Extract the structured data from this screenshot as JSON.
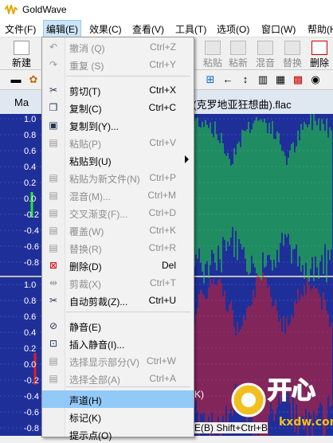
{
  "app": {
    "title": "GoldWave"
  },
  "menubar": [
    {
      "label": "文件(F)"
    },
    {
      "label": "编辑(E)"
    },
    {
      "label": "效果(C)"
    },
    {
      "label": "查看(V)"
    },
    {
      "label": "工具(T)"
    },
    {
      "label": "选项(O)"
    },
    {
      "label": "窗口(W)"
    },
    {
      "label": "帮助(H"
    }
  ],
  "toolbar": {
    "new": "新建",
    "partial_left": "",
    "paste": "粘贴",
    "paste_new": "粘新",
    "mix": "混音",
    "replace": "替换",
    "delete": "删除"
  },
  "document": {
    "title_left": "Ma",
    "title_right": "v (克罗地亚狂想曲).flac"
  },
  "wave_ticks": [
    "1.0",
    "0.8",
    "0.6",
    "0.4",
    "0.2",
    "0.0",
    "-0.2",
    "-0.4",
    "-0.6",
    "-0.8",
    "1.0",
    "0.8",
    "0.6",
    "0.4",
    "0.2",
    "0.0",
    "-0.2",
    "-0.4",
    "-0.6",
    "-0.8"
  ],
  "edit_menu": {
    "items": [
      {
        "label": "撤消 (Q)",
        "shortcut": "Ctrl+Z",
        "icon": "undo-icon",
        "disabled": true
      },
      {
        "label": "重复 (S)",
        "shortcut": "Ctrl+Y",
        "icon": "redo-icon",
        "disabled": true
      },
      {
        "label": "剪切(T)",
        "shortcut": "Ctrl+X",
        "icon": "scissors-icon",
        "disabled": false
      },
      {
        "label": "复制(C)",
        "shortcut": "Ctrl+C",
        "icon": "copy-icon",
        "disabled": false
      },
      {
        "label": "复制到(Y)...",
        "shortcut": "",
        "icon": "save-icon",
        "disabled": false
      },
      {
        "label": "粘贴(P)",
        "shortcut": "Ctrl+V",
        "icon": "paste-icon",
        "disabled": true
      },
      {
        "label": "粘贴到(U)",
        "shortcut": "",
        "icon": "",
        "disabled": false,
        "submenu": true
      },
      {
        "label": "粘贴为新文件(N)",
        "shortcut": "Ctrl+P",
        "icon": "paste-new-icon",
        "disabled": true
      },
      {
        "label": "混音(M)...",
        "shortcut": "Ctrl+M",
        "icon": "mix-icon",
        "disabled": true
      },
      {
        "label": "交叉渐变(F)...",
        "shortcut": "Ctrl+D",
        "icon": "crossfade-icon",
        "disabled": true
      },
      {
        "label": "覆盖(W)",
        "shortcut": "Ctrl+K",
        "icon": "overwrite-icon",
        "disabled": true
      },
      {
        "label": "替换(R)",
        "shortcut": "Ctrl+R",
        "icon": "replace-icon",
        "disabled": true
      },
      {
        "label": "删除(D)",
        "shortcut": "Del",
        "icon": "delete-icon",
        "disabled": false
      },
      {
        "label": "剪裁(X)",
        "shortcut": "Ctrl+T",
        "icon": "trim-icon",
        "disabled": true
      },
      {
        "label": "自动剪裁(Z)...",
        "shortcut": "Ctrl+U",
        "icon": "auto-trim-icon",
        "disabled": false
      },
      {
        "label": "静音(E)",
        "shortcut": "",
        "icon": "silence-icon",
        "disabled": false
      },
      {
        "label": "插入静音(I)...",
        "shortcut": "",
        "icon": "insert-silence-icon",
        "disabled": false
      },
      {
        "label": "选择显示部分(V)",
        "shortcut": "Ctrl+W",
        "icon": "select-view-icon",
        "disabled": true
      },
      {
        "label": "选择全部(A)",
        "shortcut": "Ctrl+A",
        "icon": "select-all-icon",
        "disabled": true
      },
      {
        "label": "声道(H)",
        "shortcut": "",
        "icon": "",
        "disabled": false,
        "highlighted": true
      },
      {
        "label": "标记(K)",
        "shortcut": "",
        "icon": "",
        "disabled": false
      },
      {
        "label": "提示点(O)",
        "shortcut": "",
        "icon": "",
        "disabled": false
      }
    ]
  },
  "behind_text": {
    "shortcut1": "K)",
    "shortcut2": "E(B) Shift+Ctrl+B"
  },
  "colors": {
    "wave_bg": "#1f2f9a",
    "wave_green": "#22e82a",
    "wave_red": "#e61b1b",
    "highlight": "#91c9f7",
    "watermark": "#f0c020"
  }
}
